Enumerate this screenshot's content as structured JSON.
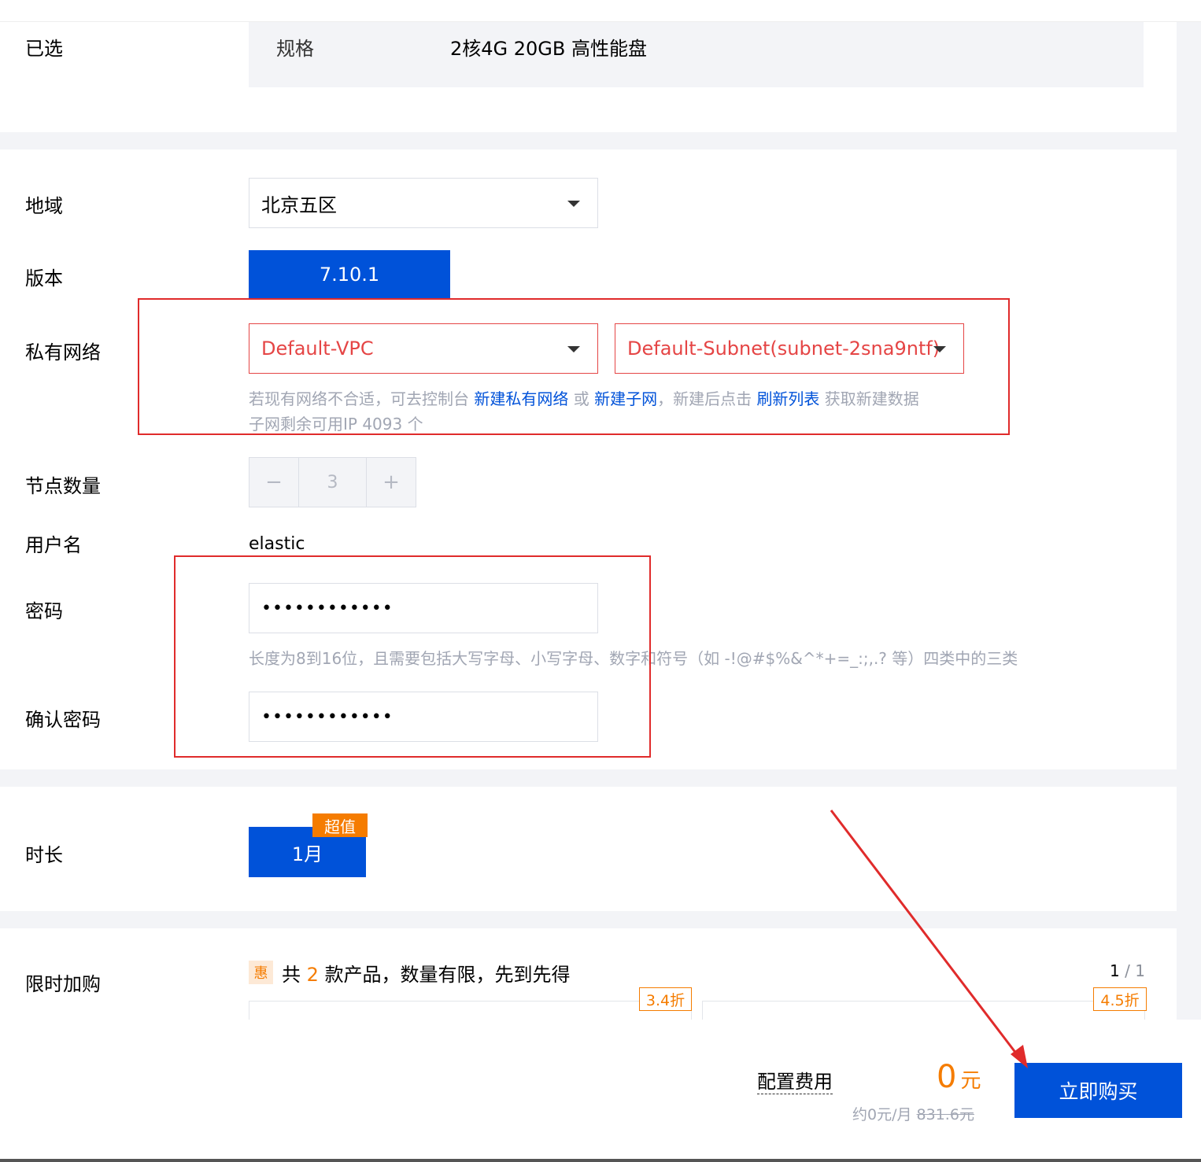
{
  "selected": {
    "label": "已选",
    "spec_key": "规格",
    "spec_value": "2核4G 20GB 高性能盘"
  },
  "region": {
    "label": "地域",
    "value": "北京五区"
  },
  "version": {
    "label": "版本",
    "value": "7.10.1"
  },
  "network": {
    "label": "私有网络",
    "vpc": "Default-VPC",
    "subnet": "Default-Subnet(subnet-2sna9ntf)",
    "hint_prefix": "若现有网络不合适，可去控制台",
    "link_new_vpc": "新建私有网络",
    "hint_or": "或",
    "link_new_subnet": "新建子网",
    "hint_mid": "，新建后点击",
    "link_refresh": "刷新列表",
    "hint_suffix": "获取新建数据",
    "ip_hint": "子网剩余可用IP 4093 个"
  },
  "nodes": {
    "label": "节点数量",
    "value": "3",
    "minus": "−",
    "plus": "+"
  },
  "username": {
    "label": "用户名",
    "value": "elastic"
  },
  "password": {
    "label": "密码",
    "value": "••••••••••••",
    "hint": "长度为8到16位，且需要包括大写字母、小写字母、数字和符号（如 -!@#$%&^*+=_:;,.? 等）四类中的三类"
  },
  "confirm_password": {
    "label": "确认密码",
    "value": "••••••••••••"
  },
  "duration": {
    "label": "时长",
    "value": "1月",
    "badge": "超值"
  },
  "limited": {
    "label": "限时加购",
    "icon_text": "惠",
    "text_prefix": "共",
    "count": "2",
    "text_suffix": "款产品，数量有限，先到先得",
    "page_current": "1",
    "page_sep": "/",
    "page_total": "1",
    "discount1": "3.4折",
    "discount2": "4.5折"
  },
  "footer": {
    "fee_label": "配置费用",
    "price": "0",
    "price_unit": "元",
    "monthly": "约0元/月",
    "original": "831.6元",
    "buy_button": "立即购买"
  },
  "colors": {
    "primary": "#0052d9",
    "error": "#e54545",
    "orange": "#f57c00",
    "annotation": "#e02b2b"
  }
}
